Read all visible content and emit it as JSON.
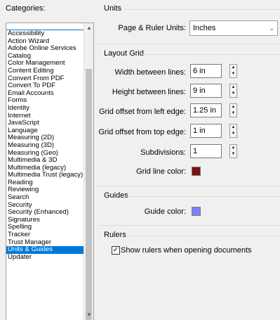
{
  "categories": {
    "label": "Categories:",
    "items": [
      "Accessibility",
      "Action Wizard",
      "Adobe Online Services",
      "Catalog",
      "Color Management",
      "Content Editing",
      "Convert From PDF",
      "Convert To PDF",
      "Email Accounts",
      "Forms",
      "Identity",
      "Internet",
      "JavaScript",
      "Language",
      "Measuring (2D)",
      "Measuring (3D)",
      "Measuring (Geo)",
      "Multimedia & 3D",
      "Multimedia (legacy)",
      "Multimedia Trust (legacy)",
      "Reading",
      "Reviewing",
      "Search",
      "Security",
      "Security (Enhanced)",
      "Signatures",
      "Spelling",
      "Tracker",
      "Trust Manager",
      "Units & Guides",
      "Updater"
    ],
    "selected": "Units & Guides"
  },
  "units": {
    "title": "Units",
    "page_ruler_label": "Page & Ruler Units:",
    "page_ruler_value": "Inches"
  },
  "layout_grid": {
    "title": "Layout Grid",
    "width_label": "Width between lines:",
    "width_value": "6 in",
    "height_label": "Height between lines:",
    "height_value": "9 in",
    "offset_left_label": "Grid offset from left edge:",
    "offset_left_value": "1.25 in",
    "offset_top_label": "Grid offset from top edge:",
    "offset_top_value": "1 in",
    "subdivisions_label": "Subdivisions:",
    "subdivisions_value": "1",
    "grid_color_label": "Grid line color:",
    "grid_color": "#7a1212"
  },
  "guides": {
    "title": "Guides",
    "guide_color_label": "Guide color:",
    "guide_color": "#8080ff"
  },
  "rulers": {
    "title": "Rulers",
    "show_rulers_label": "Show rulers when opening documents",
    "show_rulers_checked": true
  }
}
